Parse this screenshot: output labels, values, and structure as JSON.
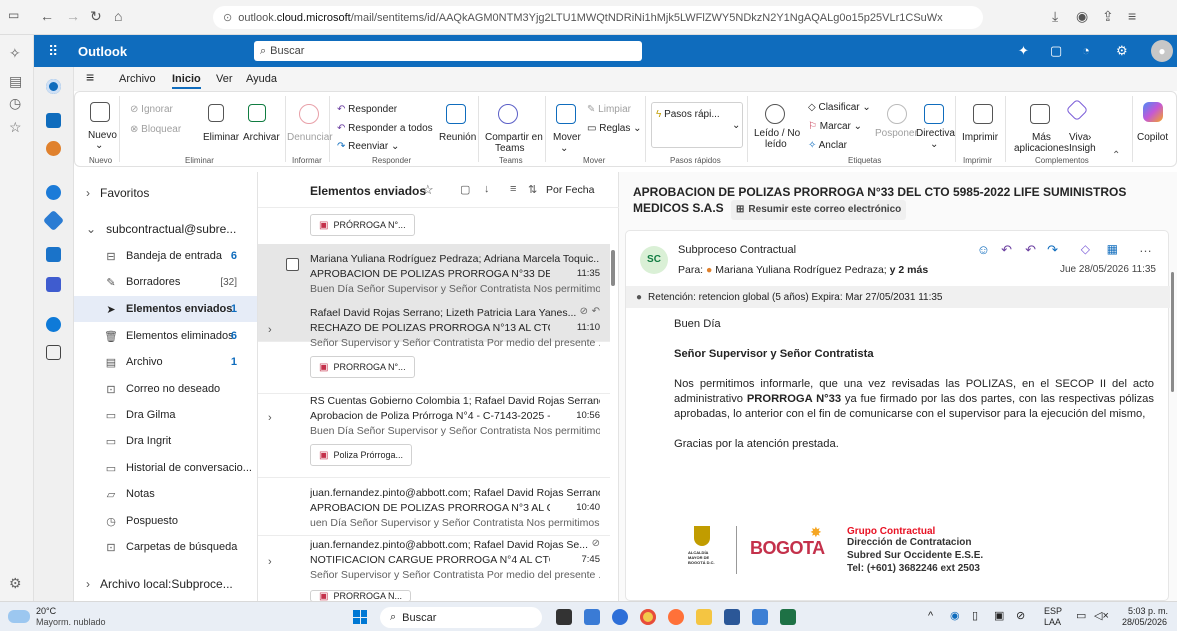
{
  "browser": {
    "url_prefix": "outlook.",
    "url_domain": "cloud.microsoft",
    "url_rest": "/mail/sentitems/id/AAQkAGM0NTM3Yjg2LTU1MWQtNDRiNi1hMjk5LWFlZWY5NDkzN2Y1NgAQALg0o15p25VLr1CSuWx"
  },
  "outlook": {
    "brand": "Outlook",
    "search_placeholder": "Buscar"
  },
  "tabs": [
    {
      "label": "Archivo"
    },
    {
      "label": "Inicio"
    },
    {
      "label": "Ver"
    },
    {
      "label": "Ayuda"
    }
  ],
  "ribbon": {
    "nuevo": "Nuevo",
    "ignorar": "Ignorar",
    "bloquear": "Bloquear",
    "eliminar": "Eliminar",
    "archivar": "Archivar",
    "denunciar": "Denunciar",
    "responder": "Responder",
    "responder_todos": "Responder a todos",
    "reenviar": "Reenviar",
    "reunion": "Reunión",
    "compartir_1": "Compartir en",
    "compartir_2": "Teams",
    "mover": "Mover",
    "limpiar": "Limpiar",
    "reglas": "Reglas",
    "pasos_rapidos_box": "Pasos rápi...",
    "leido_1": "Leído / No",
    "leido_2": "leído",
    "clasificar": "Clasificar",
    "marcar": "Marcar",
    "anclar": "Anclar",
    "posponer": "Posponer",
    "directiva": "Directiva",
    "imprimir": "Imprimir",
    "mas_1": "Más",
    "mas_2": "aplicaciones",
    "insig": "Insigh",
    "viva": "Viva",
    "copilot": "Copilot",
    "groups": {
      "nuevo": "Nuevo",
      "eliminar": "Eliminar",
      "informar": "Informar",
      "responder": "Responder",
      "teams": "Teams",
      "mover": "Mover",
      "pasos": "Pasos rápidos",
      "etiquetas": "Etiquetas",
      "imprimir": "Imprimir",
      "complementos": "Complementos"
    }
  },
  "folders": {
    "favoritos": "Favoritos",
    "account": "subcontractual@subre...",
    "items": [
      {
        "label": "Bandeja de entrada",
        "count": "6",
        "style": "bold"
      },
      {
        "label": "Borradores",
        "count": "[32]",
        "style": "gray"
      },
      {
        "label": "Elementos enviados",
        "count": "1",
        "style": "bold"
      },
      {
        "label": "Elementos eliminados",
        "count": "6",
        "style": "bold"
      },
      {
        "label": "Archivo",
        "count": "1",
        "style": "bold"
      },
      {
        "label": "Correo no deseado",
        "count": "",
        "style": ""
      },
      {
        "label": "Dra Gilma",
        "count": "",
        "style": ""
      },
      {
        "label": "Dra Ingrit",
        "count": "",
        "style": ""
      },
      {
        "label": "Historial de conversacio...",
        "count": "",
        "style": ""
      },
      {
        "label": "Notas",
        "count": "",
        "style": ""
      },
      {
        "label": "Pospuesto",
        "count": "",
        "style": ""
      },
      {
        "label": "Carpetas de búsqueda",
        "count": "",
        "style": ""
      }
    ],
    "local": "Archivo local:Subproce..."
  },
  "list": {
    "title": "Elementos enviados",
    "sort": "Por Fecha",
    "top_attachment": "PRÓRROGA N°...",
    "messages": [
      {
        "from": "Mariana Yuliana Rodríguez Pedraza; Adriana Marcela Toquic...",
        "subject": "APROBACION DE POLIZAS PRORROGA N°33 DEL CTO ...",
        "time": "11:35",
        "preview": "Buen Día Señor Supervisor y Señor Contratista Nos permitimo...",
        "attachment": ""
      },
      {
        "from": "Rafael David Rojas Serrano; Lizeth Patricia Lara Yanes...",
        "subject": "RECHAZO DE POLIZAS PRORROGA N°13 AL CTO N°60...",
        "time": "11:10",
        "preview": "Señor Supervisor y Señor Contratista Por medio del presente ...",
        "attachment": "PRORROGA N°..."
      },
      {
        "from": "RS Cuentas Gobierno Colombia 1; Rafael David Rojas Serrano",
        "subject": "Aprobacion de Poliza Prórroga N°4 - C-7143-2025 - M...",
        "time": "10:56",
        "preview": "Buen Día Señor Supervisor y Señor Contratista Nos permitimo...",
        "attachment": "Poliza Prórroga..."
      },
      {
        "from": "juan.fernandez.pinto@abbott.com; Rafael David Rojas Serrano",
        "subject": "APROBACION DE POLIZAS PRORROGA N°3 AL CTO N°...",
        "time": "10:40",
        "preview": "uen Día Señor Supervisor y Señor Contratista Nos permitimos...",
        "attachment": ""
      },
      {
        "from": "juan.fernandez.pinto@abbott.com; Rafael David Rojas Se...",
        "subject": "NOTIFICACION CARGUE PRORROGA N°4 AL CTO N°748...",
        "time": "7:45",
        "preview": "Señor Supervisor y Señor Contratista Por medio del presente ...",
        "attachment": "PRORROGA N..."
      }
    ]
  },
  "reading": {
    "subject": "APROBACION DE POLIZAS PRORROGA N°33 DEL CTO 5985-2022 LIFE SUMINISTROS MEDICOS S.A.S",
    "summarize": "Resumir este correo electrónico",
    "avatar_initials": "SC",
    "sender": "Subproceso Contractual",
    "to_label": "Para:",
    "to_name": "Mariana Yuliana Rodríguez Pedraza;",
    "to_more": "y 2 más",
    "date": "Jue 28/05/2026 11:35",
    "retention": "Retención: retencion global (5 años) Expira: Mar 27/05/2031 11:35",
    "greeting": "Buen Día",
    "salutation": "Señor Supervisor y Señor Contratista",
    "body_1": "Nos permitimos informarle, que una vez revisadas las POLIZAS, en el SECOP II del acto administrativo ",
    "body_bold": "PRORROGA N°33",
    "body_2": " ya fue firmado por las dos partes, con las respectivas pólizas aprobadas, lo anterior con el fin de comunicarse con el supervisor para la ejecución del mismo,",
    "thanks": "Gracias por la atención prestada.",
    "sig_alcaldia": "ALCALDÍA MAYOR DE BOGOTÁ D.C.",
    "sig_bogota": "BOGOTA",
    "sig_group": "Grupo Contractual",
    "sig_line1": "Dirección de Contratacion",
    "sig_line2": "Subred Sur Occidente E.S.E.",
    "sig_line3": "Tel: (+601) 3682246 ext 2503"
  },
  "taskbar": {
    "temp": "20°C",
    "weather": "Mayorm. nublado",
    "search": "Buscar",
    "lang1": "ESP",
    "lang2": "LAA",
    "time": "5:03 p. m.",
    "date": "28/05/2026"
  },
  "colors": {
    "brand_blue": "#0f6cbd",
    "alert_red": "#c4314b"
  }
}
